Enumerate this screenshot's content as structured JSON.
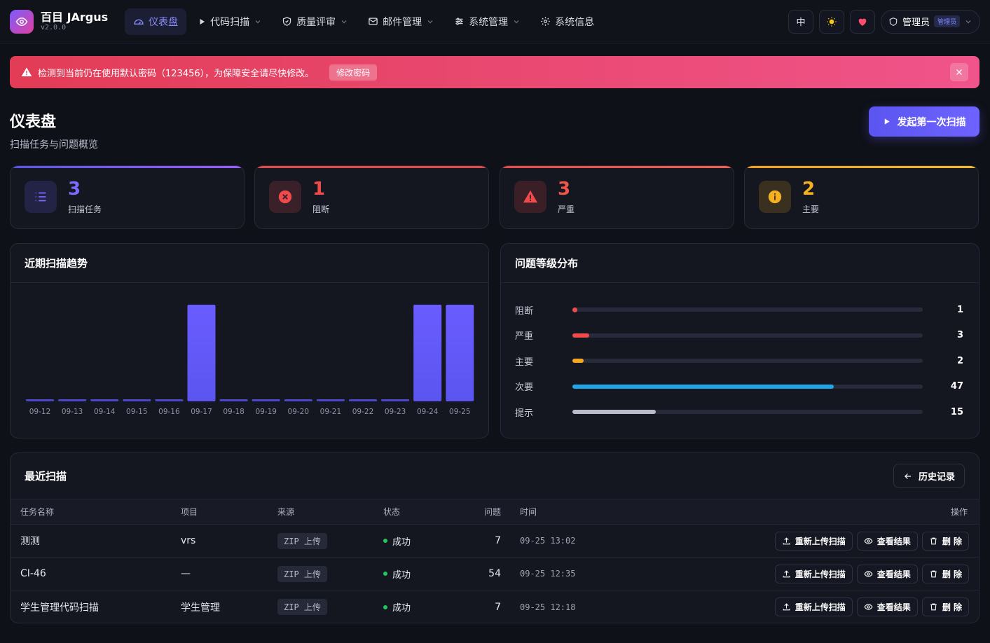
{
  "app": {
    "name": "百目 JArgus",
    "version": "v2.0.0"
  },
  "nav": [
    {
      "label": "仪表盘",
      "active": true
    },
    {
      "label": "代码扫描",
      "dropdown": true
    },
    {
      "label": "质量评审",
      "dropdown": true
    },
    {
      "label": "邮件管理",
      "dropdown": true
    },
    {
      "label": "系统管理",
      "dropdown": true
    },
    {
      "label": "系统信息"
    }
  ],
  "topbar": {
    "lang": "中",
    "user": "管理员",
    "role": "管理员"
  },
  "alert": {
    "message": "检测到当前仍在使用默认密码（123456），为保障安全请尽快修改。",
    "button": "修改密码"
  },
  "page": {
    "title": "仪表盘",
    "subtitle": "扫描任务与问题概览",
    "primary_button": "发起第一次扫描"
  },
  "stats": [
    {
      "value": "3",
      "label": "扫描任务",
      "color": "#7c6cff"
    },
    {
      "value": "1",
      "label": "阻断",
      "color": "#ef4b4b"
    },
    {
      "value": "3",
      "label": "严重",
      "color": "#f0574a"
    },
    {
      "value": "2",
      "label": "主要",
      "color": "#f5b020"
    }
  ],
  "trend": {
    "title": "近期扫描趋势"
  },
  "chart_data": {
    "type": "bar",
    "categories": [
      "09-12",
      "09-13",
      "09-14",
      "09-15",
      "09-16",
      "09-17",
      "09-18",
      "09-19",
      "09-20",
      "09-21",
      "09-22",
      "09-23",
      "09-24",
      "09-25"
    ],
    "values": [
      0,
      0,
      0,
      0,
      0,
      1,
      0,
      0,
      0,
      0,
      0,
      0,
      1,
      1
    ],
    "ylim": [
      0,
      1
    ],
    "grid": false,
    "color": "#5b55f0"
  },
  "distribution": {
    "title": "问题等级分布",
    "max": 63,
    "items": [
      {
        "label": "阻断",
        "value": 1,
        "color": "#ef4b4b"
      },
      {
        "label": "严重",
        "value": 3,
        "color": "#ef4b4b"
      },
      {
        "label": "主要",
        "value": 2,
        "color": "#f5a623"
      },
      {
        "label": "次要",
        "value": 47,
        "color": "#1ea7e8"
      },
      {
        "label": "提示",
        "value": 15,
        "color": "#b8bcc8"
      }
    ]
  },
  "recent": {
    "title": "最近扫描",
    "history_button": "历史记录",
    "columns": {
      "name": "任务名称",
      "project": "项目",
      "source": "来源",
      "status": "状态",
      "issues": "问题",
      "time": "时间",
      "actions": "操作"
    },
    "action_labels": {
      "reupload": "重新上传扫描",
      "view": "查看结果",
      "delete": "删 除"
    },
    "rows": [
      {
        "name": "测测",
        "project": "vrs",
        "source": "ZIP 上传",
        "status": "成功",
        "issues": "7",
        "time": "09-25 13:02"
      },
      {
        "name": "CI-46",
        "project": "—",
        "source": "ZIP 上传",
        "status": "成功",
        "issues": "54",
        "time": "09-25 12:35"
      },
      {
        "name": "学生管理代码扫描",
        "project": "学生管理",
        "source": "ZIP 上传",
        "status": "成功",
        "issues": "7",
        "time": "09-25 12:18"
      }
    ]
  }
}
